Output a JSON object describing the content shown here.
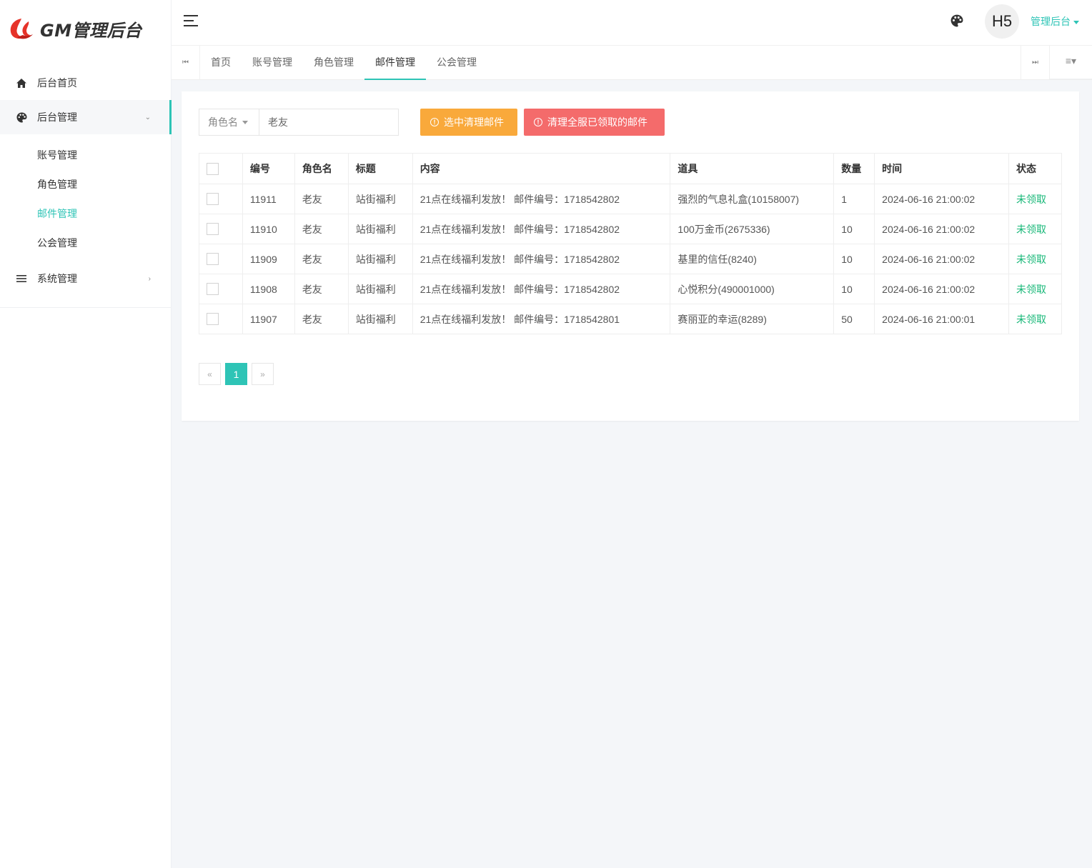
{
  "logo": {
    "text": "GM管理后台"
  },
  "sidebar": {
    "items": [
      {
        "label": "后台首页",
        "icon": "home-icon"
      },
      {
        "label": "后台管理",
        "icon": "palette-icon",
        "expanded": true
      },
      {
        "label": "系统管理",
        "icon": "list-icon",
        "expanded": false
      }
    ],
    "submenu": [
      {
        "label": "账号管理"
      },
      {
        "label": "角色管理"
      },
      {
        "label": "邮件管理",
        "active": true
      },
      {
        "label": "公会管理"
      }
    ]
  },
  "header": {
    "avatar_text": "H5",
    "user_label": "管理后台"
  },
  "tabs": [
    {
      "label": "首页"
    },
    {
      "label": "账号管理"
    },
    {
      "label": "角色管理"
    },
    {
      "label": "邮件管理",
      "active": true
    },
    {
      "label": "公会管理"
    }
  ],
  "search": {
    "field_label": "角色名",
    "value": "老友"
  },
  "buttons": {
    "clear_selected": "选中清理邮件",
    "clear_all_claimed": "清理全服已领取的邮件"
  },
  "table": {
    "columns": [
      "编号",
      "角色名",
      "标题",
      "内容",
      "道具",
      "数量",
      "时间",
      "状态"
    ],
    "rows": [
      {
        "id": "11911",
        "role": "老友",
        "title": "站街福利",
        "content": "21点在线福利发放！ 邮件编号：1718542802",
        "item": "强烈的气息礼盒(10158007)",
        "qty": "1",
        "time": "2024-06-16 21:00:02",
        "status": "未领取"
      },
      {
        "id": "11910",
        "role": "老友",
        "title": "站街福利",
        "content": "21点在线福利发放！ 邮件编号：1718542802",
        "item": "100万金币(2675336)",
        "qty": "10",
        "time": "2024-06-16 21:00:02",
        "status": "未领取"
      },
      {
        "id": "11909",
        "role": "老友",
        "title": "站街福利",
        "content": "21点在线福利发放！ 邮件编号：1718542802",
        "item": "基里的信任(8240)",
        "qty": "10",
        "time": "2024-06-16 21:00:02",
        "status": "未领取"
      },
      {
        "id": "11908",
        "role": "老友",
        "title": "站街福利",
        "content": "21点在线福利发放！ 邮件编号：1718542802",
        "item": "心悦积分(490001000)",
        "qty": "10",
        "time": "2024-06-16 21:00:02",
        "status": "未领取"
      },
      {
        "id": "11907",
        "role": "老友",
        "title": "站街福利",
        "content": "21点在线福利发放！ 邮件编号：1718542801",
        "item": "赛丽亚的幸运(8289)",
        "qty": "50",
        "time": "2024-06-16 21:00:01",
        "status": "未领取"
      }
    ]
  },
  "pager": {
    "prev": "«",
    "current": "1",
    "next": "»"
  },
  "colors": {
    "accent": "#2ec4b6",
    "warn": "#f9a93b",
    "danger": "#f46b6b",
    "status_unclaimed": "#16b777"
  }
}
